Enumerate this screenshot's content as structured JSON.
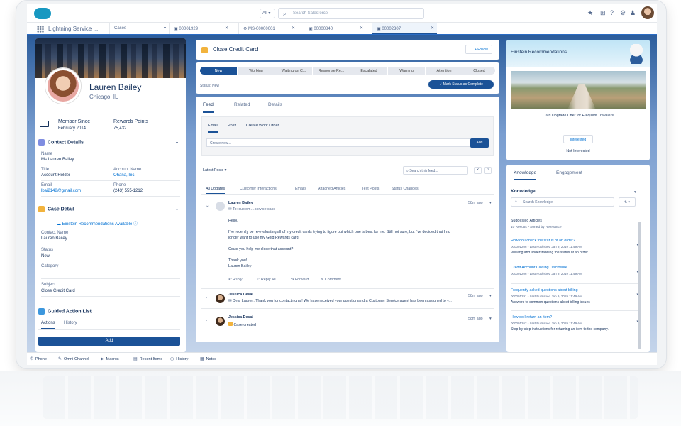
{
  "header": {
    "search_scope": "All ▾",
    "search_placeholder": "Search Salesforce"
  },
  "tabbar": {
    "app_name": "Lightning Service ...",
    "object_picker": "Cases",
    "tabs": [
      {
        "label": "00001929"
      },
      {
        "label": "MS-00000001"
      },
      {
        "label": "00000840"
      },
      {
        "label": "00002307"
      }
    ]
  },
  "contact": {
    "name": "Lauren Bailey",
    "city": "Chicago, IL",
    "member_since_label": "Member Since",
    "member_since": "February 2014",
    "rewards_label": "Rewards Points",
    "rewards": "75,432",
    "section_title": "Contact Details",
    "name_label": "Name",
    "name_value": "Ms Lauren Bailey",
    "title_label": "Title",
    "title_value": "Account Holder",
    "account_label": "Account Name",
    "account_value": "Ohana, Inc.",
    "email_label": "Email",
    "email_value": "lbai2148@gmail.com",
    "phone_label": "Phone",
    "phone_value": "(243) 555-1212"
  },
  "case_detail": {
    "section_title": "Case Detail",
    "einstein_label": "Einstein Recommendations Available",
    "contact_name_label": "Contact Name",
    "contact_name": "Lauren Bailey",
    "status_label": "Status",
    "status": "New",
    "category_label": "Category",
    "category": "-",
    "subject_label": "Subject",
    "subject": "Close Credit Card"
  },
  "guided": {
    "title": "Guided Action List",
    "tab_actions": "Actions",
    "tab_history": "History",
    "add": "Add"
  },
  "case": {
    "title": "Close Credit Card",
    "follow": "+ Follow",
    "stages": [
      "New",
      "Working",
      "Waiting on C...",
      "Response Re...",
      "Escalated",
      "Warning",
      "Attention",
      "Closed"
    ],
    "status_text": "Status: New",
    "mark_complete": "✓ Mark Status as Complete"
  },
  "feed": {
    "tabs": [
      "Feed",
      "Related",
      "Details"
    ],
    "publisher_tabs": [
      "Email",
      "Post",
      "Create Work Order"
    ],
    "create_placeholder": "Create new...",
    "add": "Add",
    "latest": "Latest Posts",
    "search_placeholder": "Search this feed...",
    "filters": [
      "All Updates",
      "Customer Interactions",
      "Emails",
      "Attached Articles",
      "Text Posts",
      "Status Changes"
    ],
    "post1": {
      "author": "Lauren Bailey",
      "to": "To: custom",
      "to_suffix": "service.case",
      "time": "58m ago",
      "greeting": "Hello,",
      "body1": "I've recently be re-evaluating all of my credit cards trying to figure out which one is best for me.  Still not sure, but I've decided that I no",
      "body2": "longer want to use my Gold Rewards card.",
      "body3": "Could you help me close that account?",
      "thanks": "Thank you!",
      "sign": "Lauren Bailey",
      "actions": [
        "Reply",
        "Reply All",
        "Forward",
        "Comment"
      ]
    },
    "post2": {
      "author": "Jessica Desai",
      "time": "58m ago",
      "text": "Dear Lauren, Thank you for contacting us! We have received your question and a Customer Service agent has been assigned to y..."
    },
    "post3": {
      "author": "Jessica Desai",
      "time": "58m ago",
      "text": "Case created"
    }
  },
  "einstein": {
    "title": "Einstein Recommendations",
    "offer": "Card Upgrade Offer for Frequent Travelers",
    "interested": "Interested",
    "not_interested": "Not Interested"
  },
  "knowledge": {
    "tabs": [
      "Knowledge",
      "Engagement"
    ],
    "heading": "Knowledge",
    "search_placeholder": "Search Knowledge",
    "filter_btn": "⇅ ▾",
    "suggested": "Suggested Articles",
    "results": "10 Results • Sorted by Relevance",
    "articles": [
      {
        "title": "How do I check the status of an order?",
        "meta": "000001206  •  Last Published  Jan 9, 2019 11:49 AM",
        "desc": "Viewing and understanding the status of an order."
      },
      {
        "title": "Credit Account Closing Disclosure",
        "meta": "000001206  •  Last Published  Jan 9, 2019 11:49 AM",
        "desc": ""
      },
      {
        "title": "Frequently asked questions about billing",
        "meta": "000001291  •  Last Published  Jan 9, 2019 11:49 AM",
        "desc": "Answers to common questions about billing issues"
      },
      {
        "title": "How do I return an item?",
        "meta": "000001262  •  Last Published  Jan 9, 2019 11:49 AM",
        "desc": "Step-by-step instructions for returning an item to the company."
      }
    ]
  },
  "utility": [
    "Phone",
    "Omni-Channel",
    "Macros",
    "Recent Items",
    "History",
    "Notes"
  ]
}
